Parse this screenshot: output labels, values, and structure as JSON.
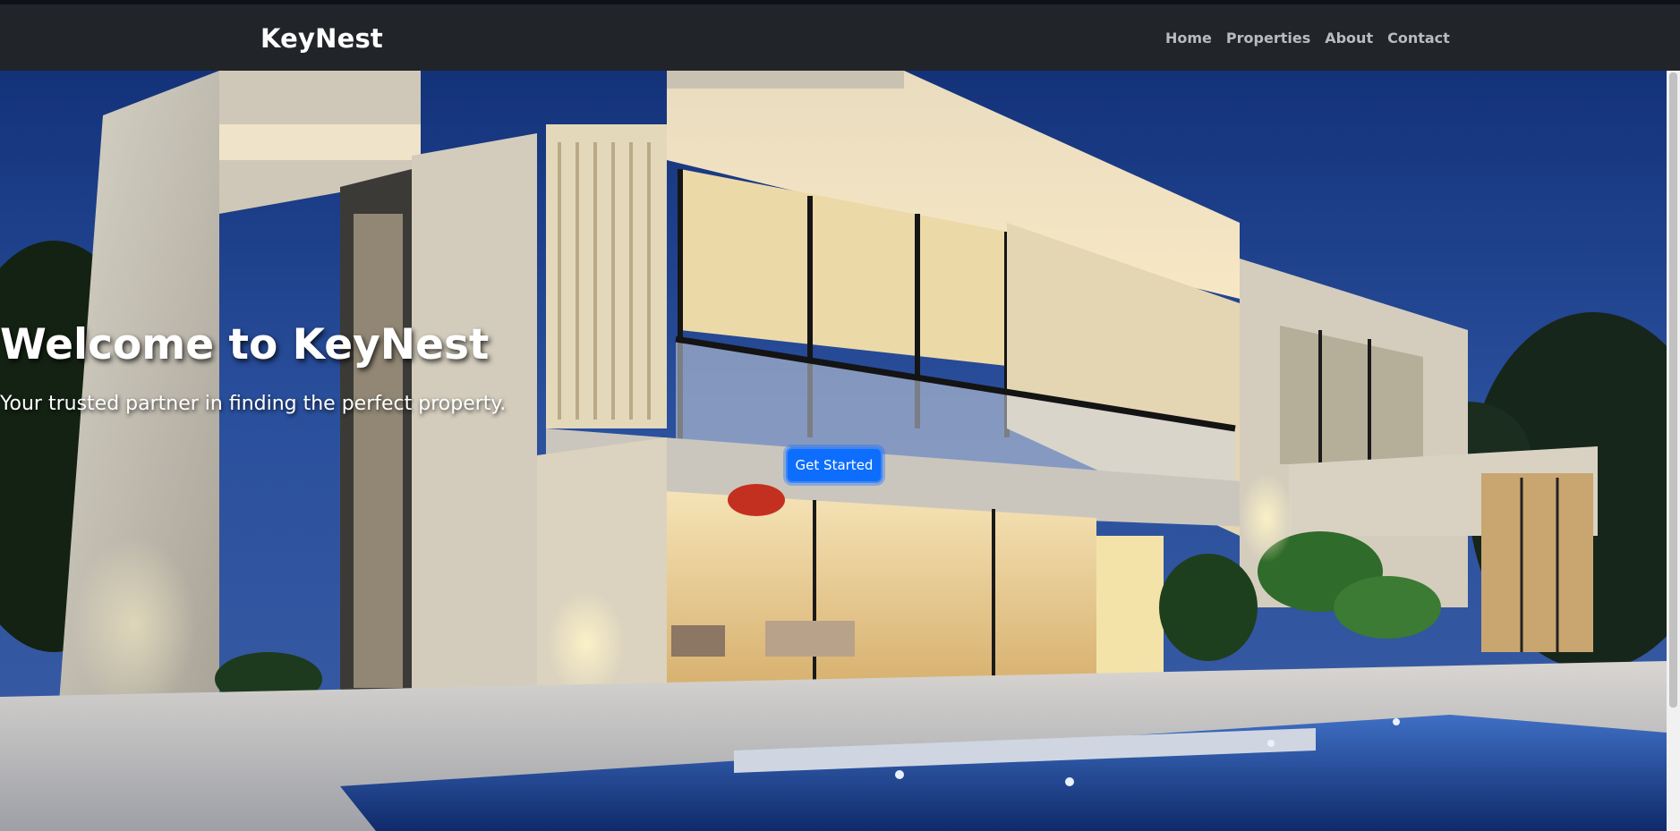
{
  "navbar": {
    "brand": "KeyNest",
    "links": [
      "Home",
      "Properties",
      "About",
      "Contact"
    ]
  },
  "hero": {
    "title": "Welcome to KeyNest",
    "subtitle": "Your trusted partner in finding the perfect property.",
    "cta_label": "Get Started",
    "background": "modern-villa-night-photo"
  },
  "colors": {
    "navbar_bg": "#212529",
    "nav_link": "#b8bcc1",
    "cta_bg": "#0d6efd",
    "sky": "#1b3b86"
  }
}
